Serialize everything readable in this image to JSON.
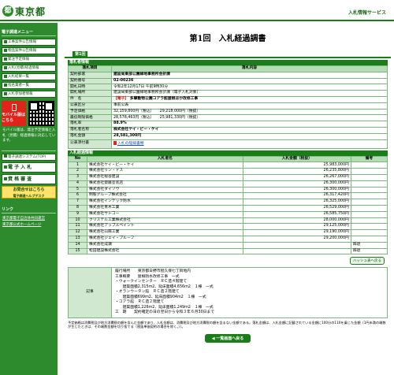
{
  "header": {
    "logo_mark": "都",
    "logo_text": "東京都",
    "service": "入札情報サービス"
  },
  "sidebar": {
    "heading": "電子調達メニュー",
    "items": [
      "工事案件公告情報",
      "物品案件公告情報",
      "発注予定情報",
      "入札(見積)経過情報",
      "入札結果一覧",
      "指名業者一覧",
      "入札参加者情報"
    ],
    "mobile_label": "モバイル版はこちら",
    "note": "モバイル版は、発注予定情報と入札（見積）経過情報に対応しています。",
    "big_items": [
      "電子調達システム(TOP)",
      "電 子 入 札",
      "資 格 審 査"
    ],
    "help": "お問合せはこちら",
    "help_sub": "電子調達ヘルプデスク",
    "links_heading": "リンク",
    "links": [
      "東京都電子自治体共同運営",
      "東京都公式ホームページ"
    ]
  },
  "page": {
    "title_a": "第1回",
    "title_b": "入札経過調書",
    "tab": "第1回"
  },
  "info": {
    "section": "落札者情報",
    "col_item": "落札項目",
    "col_content": "落札内容",
    "rows": {
      "keiyaku_bu": {
        "label": "契約部署",
        "value": "建設局東部公園緑地事務所会計課"
      },
      "keiyaku_no": {
        "label": "契約番号",
        "value": "02-00236"
      },
      "kaisatsu_date": {
        "label": "開札日時",
        "value": "令和2年12月17日 午前9時30分"
      },
      "kaisatsu_place": {
        "label": "開札場所",
        "value": "建設局東部公園緑地事務所会計課（電子入札対象）"
      },
      "kenmei": {
        "label": "件　名",
        "tag": "【電子】",
        "value": "多摩動物公園コアラ館屋根ほか改修工事"
      },
      "kokoku": {
        "label": "公表区分",
        "value": "事前公表"
      },
      "yotei": {
        "label": "予定価格",
        "value": "32,159,800円（税込）　　29,218,000円（税抜）"
      },
      "saitei": {
        "label": "最低制限価格",
        "value": "28,578,463円（税込）　　25,981,330円（税抜）"
      },
      "rakusatsu_ritsu": {
        "label": "落札率",
        "value": "88.9%"
      },
      "rakusatsu_sha": {
        "label": "落札者名称",
        "value": "株式会社ケイ・ビー・ケイ"
      },
      "rakusatsu_kin": {
        "label": "落札金額",
        "value": "28,581,300円"
      },
      "kokai": {
        "label": "公表添付書",
        "value": "入札の経緯書類"
      }
    }
  },
  "bids": {
    "section": "入札経過情報",
    "headers": [
      "No",
      "入札者名",
      "入札金額（税抜）",
      "備考"
    ],
    "rows": [
      {
        "no": "1",
        "name": "株式会社ケイ・ビー・ケイ",
        "amount": "25,983,000円",
        "note": ""
      },
      {
        "no": "2",
        "name": "株式会社リン・ドス",
        "amount": "26,235,800円",
        "note": ""
      },
      {
        "no": "3",
        "name": "株式会社秘谷建設",
        "amount": "26,267,000円",
        "note": ""
      },
      {
        "no": "4",
        "name": "株式会社齋藤塗装店",
        "amount": "26,300,000円",
        "note": ""
      },
      {
        "no": "5",
        "name": "株式会社ダイソウ",
        "amount": "26,300,000円",
        "note": ""
      },
      {
        "no": "6",
        "name": "明聖グループ株式会社",
        "amount": "26,317,420円",
        "note": ""
      },
      {
        "no": "7",
        "name": "株式会社インテック防水",
        "amount": "26,325,000円",
        "note": ""
      },
      {
        "no": "8",
        "name": "株式会社青木工業",
        "amount": "26,529,000円",
        "note": ""
      },
      {
        "no": "9",
        "name": "株式会社サトコー",
        "amount": "26,585,750円",
        "note": ""
      },
      {
        "no": "10",
        "name": "クリステル工業株式会社",
        "amount": "28,000,000円",
        "note": ""
      },
      {
        "no": "11",
        "name": "株式会社アップルペイント",
        "amount": "29,125,000円",
        "note": ""
      },
      {
        "no": "12",
        "name": "株式会社山陽工業",
        "amount": "29,190,000円",
        "note": ""
      },
      {
        "no": "13",
        "name": "株式会社ジェイ・プルーフ",
        "amount": "29,200,000円",
        "note": ""
      },
      {
        "no": "14",
        "name": "株式会社成瀬",
        "amount": "",
        "note": "辞退"
      },
      {
        "no": "15",
        "name": "松田建設株式会社",
        "amount": "",
        "note": "辞退"
      }
    ],
    "list_button": "ハッシュ表へ戻る"
  },
  "memo": {
    "label": "記事",
    "text": "履行場所　　東京都日野市程久保七丁目地内\n工事概要　　屋根防水改修工事　一式\n・ウォークインセンター　ＲＣ造４階建て\n　　建築面積2,315ｍ2、延床面積4,656ｍ2　１棟　一式\n・オランウータン館　ＲＣ造２階建て\n　　建築面積699ｍ2、延床面積904ｍ2　１棟　一式\n・コアラ館　ＲＣ造２階建て\n　　建築面積1,226ｍ2、延床面積1,249ｍ2　１棟　一式\n工　期　　契約確定の日の翌日から令和３年６月30日まで"
  },
  "footnote": "予定価格は消費税及び地方消費税の額を含んだ金額であり、入札金額は、消費税及び地方消費税の額を含まない金額である。落札金額は、入札金額に記載されている金額に100分の110を乗じた金額（1円未満の端数が生じたときは、その端数金額を切り捨てる（税抜単価契約の場合を除く。））。",
  "back_button": "◀ 一覧画面へ戻る"
}
